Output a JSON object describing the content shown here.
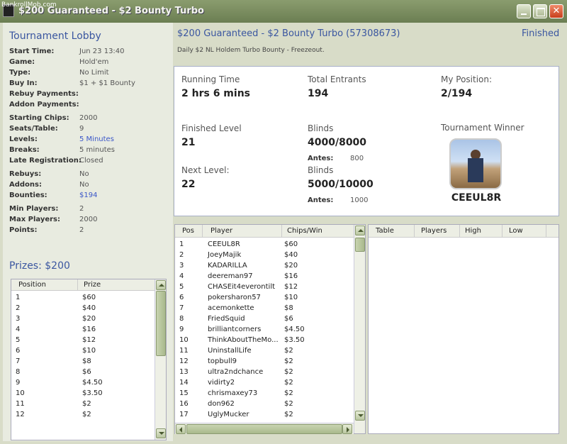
{
  "window": {
    "title": "$200 Guaranteed - $2 Bounty Turbo",
    "watermark": "BankrollMob.com"
  },
  "lobby": {
    "title": "Tournament Lobby",
    "info": [
      {
        "key": "Start Time:",
        "value": "Jun 23 13:40"
      },
      {
        "key": "Game:",
        "value": "Hold'em"
      },
      {
        "key": "Type:",
        "value": "No Limit"
      },
      {
        "key": "Buy In:",
        "value": "$1 + $1 Bounty"
      },
      {
        "key": "Rebuy Payments:",
        "value": ""
      },
      {
        "key": "Addon Payments:",
        "value": ""
      },
      {
        "key": "Starting Chips:",
        "value": "2000"
      },
      {
        "key": "Seats/Table:",
        "value": "9"
      },
      {
        "key": "Levels:",
        "value": "5 Minutes"
      },
      {
        "key": "Breaks:",
        "value": "5 minutes"
      },
      {
        "key": "Late Registration:",
        "value": "Closed"
      },
      {
        "key": "Rebuys:",
        "value": "No"
      },
      {
        "key": "Addons:",
        "value": "No"
      },
      {
        "key": "Bounties:",
        "value": "$194"
      },
      {
        "key": "Min Players:",
        "value": "2"
      },
      {
        "key": "Max Players:",
        "value": "2000"
      },
      {
        "key": "Points:",
        "value": "2"
      }
    ]
  },
  "prizes": {
    "title": "Prizes: $200",
    "col_position": "Position",
    "col_prize": "Prize",
    "rows": [
      [
        "1",
        "$60"
      ],
      [
        "2",
        "$40"
      ],
      [
        "3",
        "$20"
      ],
      [
        "4",
        "$16"
      ],
      [
        "5",
        "$12"
      ],
      [
        "6",
        "$10"
      ],
      [
        "7",
        "$8"
      ],
      [
        "8",
        "$6"
      ],
      [
        "9",
        "$4.50"
      ],
      [
        "10",
        "$3.50"
      ],
      [
        "11",
        "$2"
      ],
      [
        "12",
        "$2"
      ]
    ]
  },
  "tournament": {
    "title": "$200 Guaranteed - $2 Bounty Turbo (57308673)",
    "status": "Finished",
    "subtitle": "Daily $2 NL Holdem Turbo Bounty - Freezeout.",
    "running_time_label": "Running Time",
    "running_time": "2 hrs 6 mins",
    "total_entrants_label": "Total Entrants",
    "total_entrants": "194",
    "my_position_label": "My Position:",
    "my_position": "2/194",
    "finished_level_label": "Finished Level",
    "finished_level": "21",
    "blinds_label": "Blinds",
    "blinds": "4000/8000",
    "antes_label": "Antes:",
    "antes": "800",
    "next_level_label": "Next Level:",
    "next_level": "22",
    "next_blinds_label": "Blinds",
    "next_blinds": "5000/10000",
    "next_antes_label": "Antes:",
    "next_antes": "1000",
    "winner_label": "Tournament Winner",
    "winner": "CEEUL8R"
  },
  "players": {
    "col_pos": "Pos",
    "col_player": "Player",
    "col_chips": "Chips/Win",
    "rows": [
      [
        "1",
        "CEEUL8R",
        "$60"
      ],
      [
        "2",
        "JoeyMajik",
        "$40"
      ],
      [
        "3",
        "KADARILLA",
        "$20"
      ],
      [
        "4",
        "deereman97",
        "$16"
      ],
      [
        "5",
        "CHASEit4everontilt",
        "$12"
      ],
      [
        "6",
        "pokersharon57",
        "$10"
      ],
      [
        "7",
        "acemonkette",
        "$8"
      ],
      [
        "8",
        "FriedSquid",
        "$6"
      ],
      [
        "9",
        "brilliantcorners",
        "$4.50"
      ],
      [
        "10",
        "ThinkAboutTheMo...",
        "$3.50"
      ],
      [
        "11",
        "UninstallLife",
        "$2"
      ],
      [
        "12",
        "topbull9",
        "$2"
      ],
      [
        "13",
        "ultra2ndchance",
        "$2"
      ],
      [
        "14",
        "vidirty2",
        "$2"
      ],
      [
        "15",
        "chrismaxey73",
        "$2"
      ],
      [
        "16",
        "don962",
        "$2"
      ],
      [
        "17",
        "UglyMucker",
        "$2"
      ]
    ]
  },
  "tables": {
    "col_table": "Table",
    "col_players": "Players",
    "col_high": "High",
    "col_low": "Low"
  }
}
